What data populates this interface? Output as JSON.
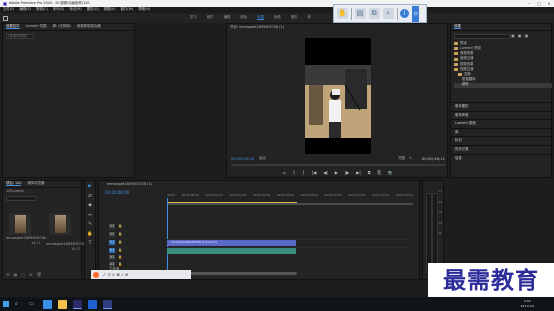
{
  "window": {
    "title": "Adobe Premiere Pro 2020 - D:\\视频\\动画制作\\120"
  },
  "menu": [
    "文件(F)",
    "编辑(E)",
    "剪辑(C)",
    "序列(S)",
    "标记(M)",
    "图形(G)",
    "视图(V)",
    "窗口(W)",
    "帮助(H)"
  ],
  "workspace_tabs": [
    "学习",
    "组件",
    "编辑",
    "颜色",
    "效果",
    "音频",
    "图形",
    "库"
  ],
  "active_workspace": "效果",
  "source_panel": {
    "tabs": [
      "效果控件",
      "Lumetri 范围",
      "源: (无剪辑)",
      "音频剪辑混合器"
    ],
    "field_placeholder": "(未选择剪辑)"
  },
  "program_monitor": {
    "title": "节目: mmexport1609405728 (1)",
    "timecode": "00;00;00;00",
    "fit": "适合",
    "resolution": "完整",
    "duration": "00;00;18;11"
  },
  "effects_panel": {
    "title": "效果",
    "tree": [
      "预设",
      "Lumetri 预设",
      "音频效果",
      "音频过渡",
      "视频效果",
      "视频过渡",
      "变换",
      "垂直翻转",
      "翻转"
    ],
    "sections": [
      "基本图形",
      "基本声音",
      "Lumetri 颜色",
      "库",
      "标记",
      "历史记录",
      "信息"
    ]
  },
  "project_panel": {
    "tabs": [
      "项目: 120",
      "媒体浏览器"
    ],
    "path": "120.prproj",
    "items": [
      {
        "name": "mmexport1609405728...",
        "duration": "18;11"
      },
      {
        "name": "mmexport1609405728...",
        "duration": "18;11"
      }
    ]
  },
  "tools": [
    "▶",
    "⇄",
    "◆",
    "↔",
    "✎",
    "✋",
    "T"
  ],
  "timeline": {
    "sequence": "mmexport1609405728 (1)",
    "timecode": "00;00;00;00",
    "ruler": [
      "00;00",
      "00;00;08;00",
      "00;00;16;00",
      "00;00;24;00",
      "00;00;32;00",
      "00;00;40;00",
      "00;00;48;00",
      "00;00;56;00",
      "00;01;04;02",
      "00;01;12;02",
      "00;01;20;02"
    ],
    "tracks": [
      "V3",
      "V2",
      "V1",
      "A1",
      "A2",
      "A3"
    ],
    "video_clip": "mmexport1609405728 (1).mp4 [V]",
    "audio_clip": "",
    "master": "主声道"
  },
  "audio_meter": {
    "scale": [
      "-12",
      "-24",
      "-36",
      "-48",
      "dB"
    ]
  },
  "transport": [
    "⌂",
    "{",
    "}",
    "|◀",
    "◀|",
    "▶",
    "|▶",
    "▶|",
    "⧉",
    "⎘",
    "📷"
  ],
  "float_toolbar": {
    "icons": [
      "hand-icon",
      "folder-icon",
      "copy-icon",
      "search-icon",
      "info-icon"
    ]
  },
  "taskbar": {
    "time": "9:46",
    "date": "2021/1/4"
  },
  "watermark": "最需教育",
  "bot_text": "ノ ↺ ⊙ ✿ ♪ ⊞"
}
